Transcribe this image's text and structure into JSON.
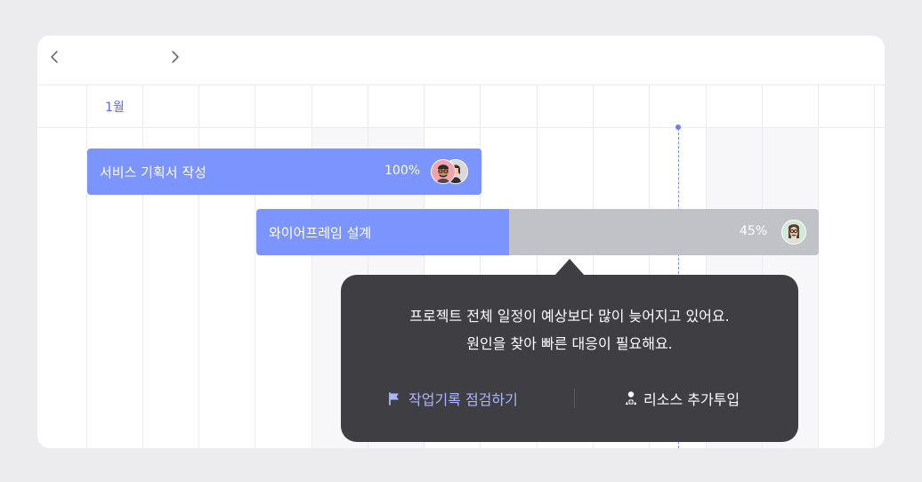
{
  "calendar": {
    "month_label": "1월",
    "prev_icon": "chevron-left-icon",
    "next_icon": "chevron-right-icon"
  },
  "tasks": [
    {
      "name": "서비스 기획서 작성",
      "progress_label": "100%",
      "progress": 1.0,
      "assignees": [
        "avatar-man-glasses",
        "avatar-woman"
      ]
    },
    {
      "name": "와이어프레임 설계",
      "progress_label": "45%",
      "progress": 0.45,
      "assignees": [
        "avatar-woman-glasses"
      ]
    }
  ],
  "tooltip": {
    "line1": "프로젝트 전체 일정이 예상보다 많이 늦어지고 있어요.",
    "line2": "원인을 찾아 빠른 대응이 필요해요.",
    "action_review": {
      "label": "작업기록 점검하기",
      "icon": "flag-icon"
    },
    "action_resource": {
      "label": "리소스 추가투입",
      "icon": "add-person-icon"
    }
  },
  "colors": {
    "bar_fill": "#7b94fe",
    "bar_remaining": "#c0c2c8",
    "accent": "#5b6cf5",
    "tooltip_bg": "#3f3f43",
    "action_link": "#a9b6ff"
  }
}
